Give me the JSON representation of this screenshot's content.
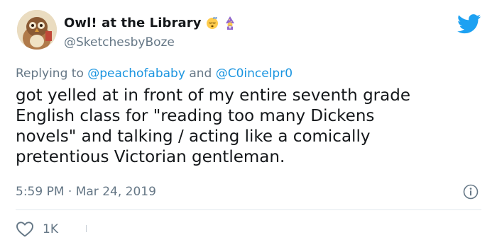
{
  "author": {
    "display_name": "Owl! at the Library",
    "handle": "@SketchesbyBoze",
    "name_emojis": [
      "sleeping-face-icon",
      "mage-icon"
    ]
  },
  "reply": {
    "prefix": "Replying to",
    "mention_1": "@peachofababy",
    "conjunction": "and",
    "mention_2": "@C0incelpr0"
  },
  "tweet": {
    "text": "got yelled at in front of my entire seventh grade\nEnglish class for \"reading too many Dickens\nnovels\" and talking / acting like a comically\npretentious Victorian gentleman.",
    "time": "5:59 PM",
    "separator": "·",
    "date": "Mar 24, 2019"
  },
  "actions": {
    "like_count": "1K"
  },
  "colors": {
    "brand": "#1da1f2",
    "link": "#1b95e0",
    "secondary_text": "#657786",
    "primary_text": "#14171a",
    "divider": "#e1e8ed"
  }
}
